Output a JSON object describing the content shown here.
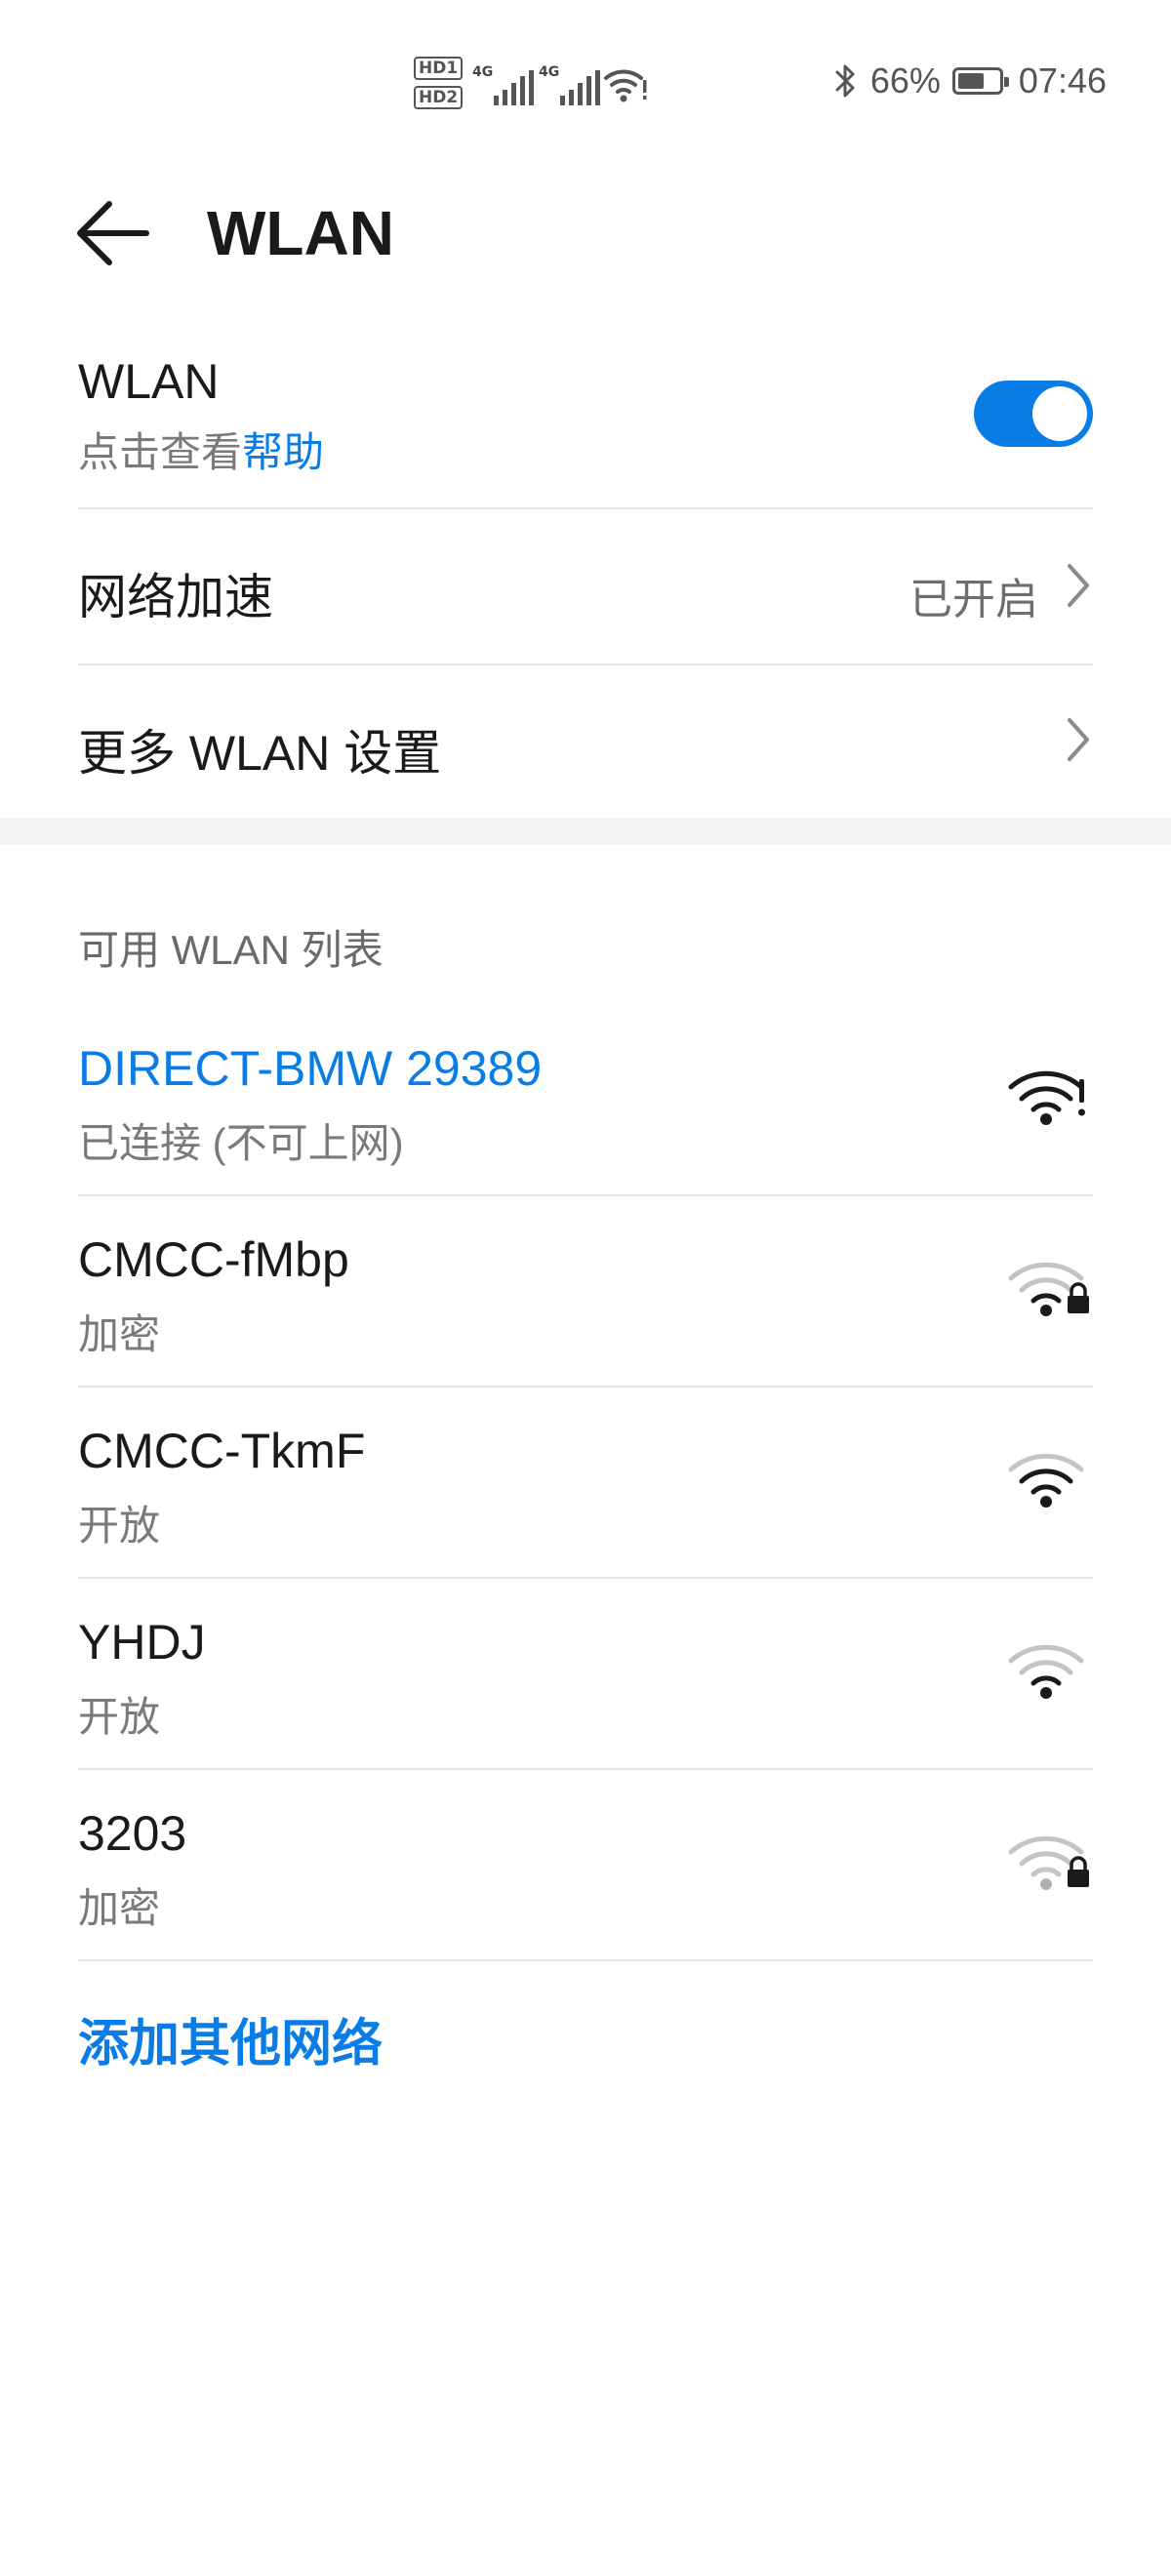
{
  "status_bar": {
    "sim1": "HD1",
    "sim2": "HD2",
    "net1": "4G",
    "net2": "4G",
    "battery_percent_text": "66%",
    "battery_level": 0.66,
    "time": "07:46"
  },
  "header": {
    "title": "WLAN"
  },
  "wlan_toggle": {
    "label": "WLAN",
    "help_prefix": "点击查看",
    "help_link": "帮助",
    "enabled": true
  },
  "settings": {
    "acceleration": {
      "label": "网络加速",
      "value": "已开启"
    },
    "more": {
      "label": "更多 WLAN 设置"
    }
  },
  "networks": {
    "section_title": "可用 WLAN 列表",
    "items": [
      {
        "name": "DIRECT-BMW 29389",
        "status": "已连接 (不可上网)",
        "connected": true,
        "secured": false,
        "signal": 3,
        "icon": "wifi-no-internet-icon"
      },
      {
        "name": "CMCC-fMbp",
        "status": "加密",
        "connected": false,
        "secured": true,
        "signal": 1,
        "icon": "wifi-locked-icon"
      },
      {
        "name": "CMCC-TkmF",
        "status": "开放",
        "connected": false,
        "secured": false,
        "signal": 2,
        "icon": "wifi-icon"
      },
      {
        "name": "YHDJ",
        "status": "开放",
        "connected": false,
        "secured": false,
        "signal": 1,
        "icon": "wifi-icon"
      },
      {
        "name": "3203",
        "status": "加密",
        "connected": false,
        "secured": true,
        "signal": 0,
        "icon": "wifi-locked-icon"
      }
    ],
    "add_other": "添加其他网络"
  },
  "colors": {
    "accent": "#0a7ce6",
    "text_primary": "#1a1a1a",
    "text_secondary": "#7a7a7a",
    "divider": "#e2e2e2",
    "section_gap": "#f4f4f4"
  }
}
